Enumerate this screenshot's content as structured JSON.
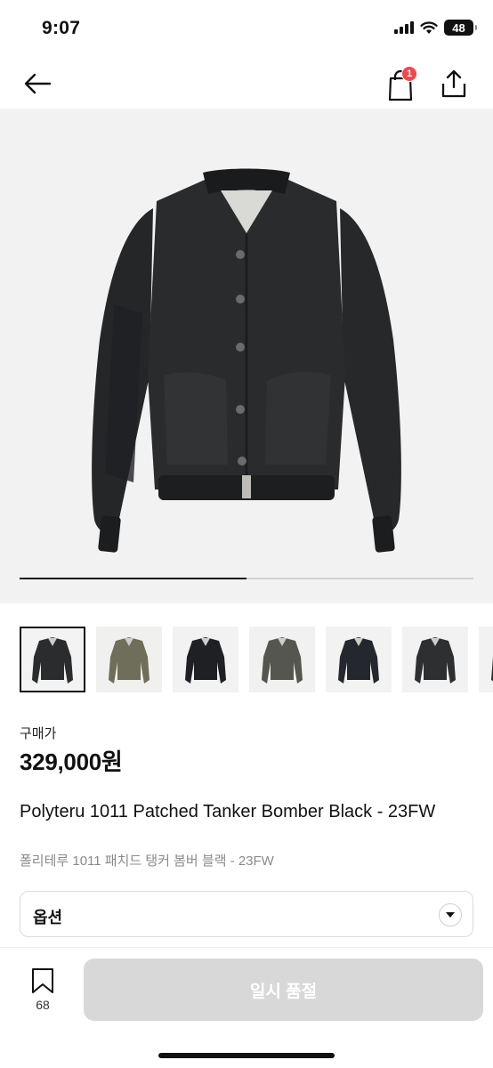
{
  "status": {
    "time": "9:07",
    "battery": "48"
  },
  "header": {
    "cart_count": "1"
  },
  "gallery": {
    "current_index": 1,
    "total_images": 2.3
  },
  "thumbnails": [
    {
      "color": "#2b2c2e",
      "bg": "#f3f3f3"
    },
    {
      "color": "#6f6e5a",
      "bg": "#f0f0ee"
    },
    {
      "color": "#1f2024",
      "bg": "#f2f2f2"
    },
    {
      "color": "#55564f",
      "bg": "#f1f1f1"
    },
    {
      "color": "#24272d",
      "bg": "#f2f2f2"
    },
    {
      "color": "#2e2f31",
      "bg": "#f2f2f2"
    },
    {
      "color": "#2a2b2d",
      "bg": "#f2f2f2"
    }
  ],
  "product": {
    "price_label": "구매가",
    "price": "329,000원",
    "title_en": "Polyteru 1011 Patched Tanker Bomber Black - 23FW",
    "title_ko": "폴리테루 1011 패치드 탱커 봄버 블랙 - 23FW"
  },
  "option": {
    "label": "옵션"
  },
  "bottom": {
    "bookmark_count": "68",
    "cta_label": "일시 품절"
  },
  "colors": {
    "cta_bg": "#d8d8d8",
    "badge": "#f0484a",
    "jacket": "#2a2b2d"
  }
}
